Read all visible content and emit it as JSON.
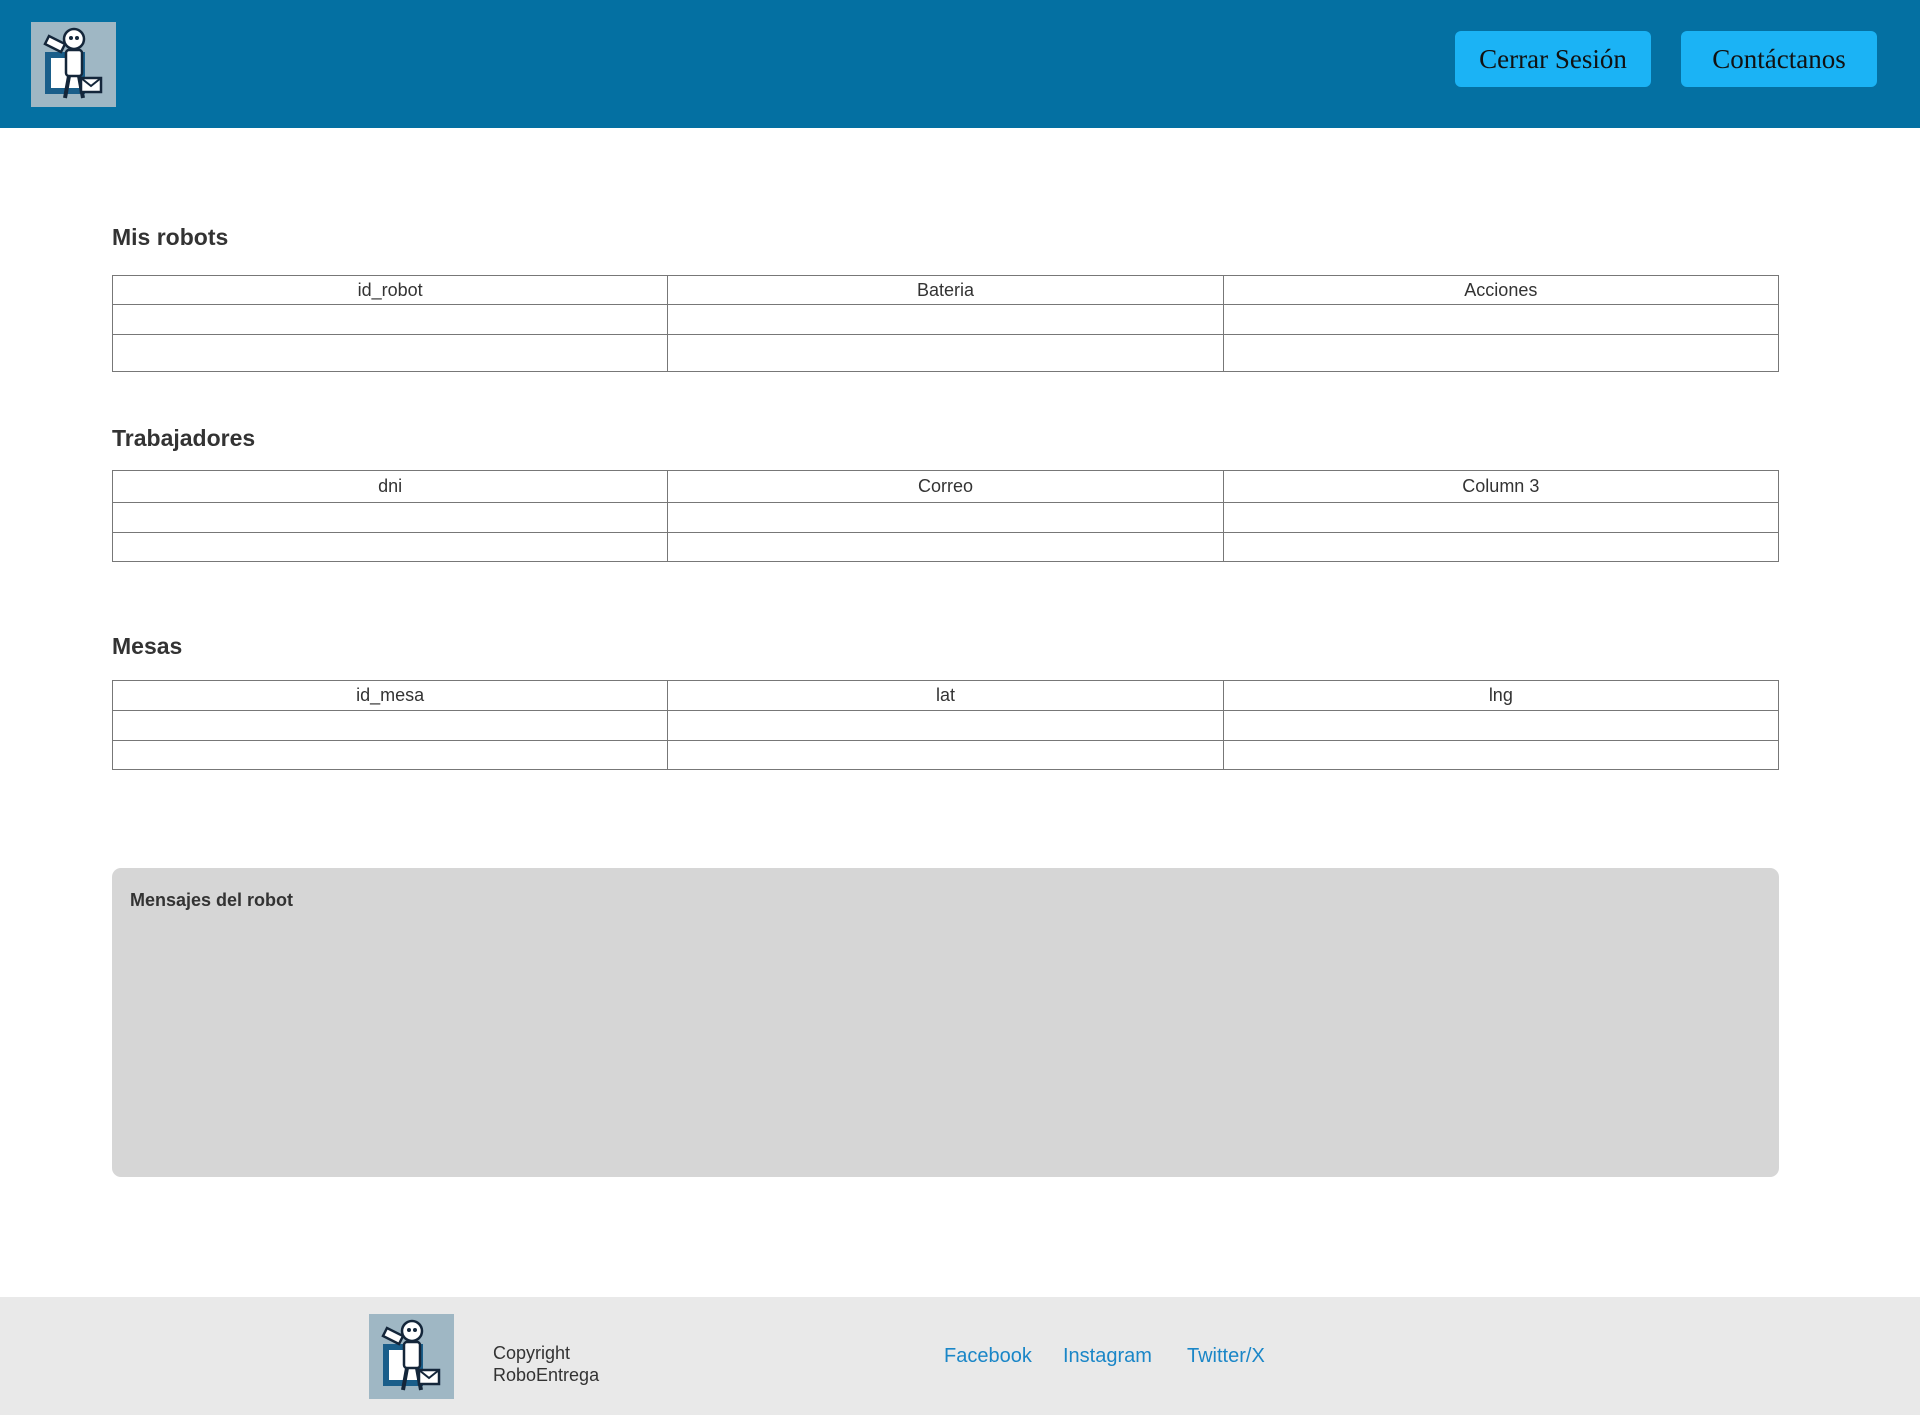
{
  "header": {
    "logout_label": "Cerrar Sesión",
    "contact_label": "Contáctanos"
  },
  "robots": {
    "title": "Mis robots",
    "columns": [
      "id_robot",
      "Bateria",
      "Acciones"
    ]
  },
  "workers": {
    "title": "Trabajadores",
    "columns": [
      "dni",
      "Correo",
      "Column 3"
    ]
  },
  "tables_section": {
    "title": "Mesas",
    "columns": [
      "id_mesa",
      "lat",
      "lng"
    ]
  },
  "messages": {
    "title": "Mensajes del robot"
  },
  "footer": {
    "copyright_line1": "Copyright",
    "copyright_line2": "RoboEntrega",
    "links": [
      "Facebook",
      "Instagram",
      "Twitter/X"
    ]
  },
  "colors": {
    "header_bg": "#0470a2",
    "button_bg": "#1bb3f5",
    "messages_bg": "#d6d6d6",
    "footer_bg": "#e9e9e9",
    "link": "#1a86c7"
  },
  "icons": {
    "logo": "robot-delivery-logo-icon"
  }
}
